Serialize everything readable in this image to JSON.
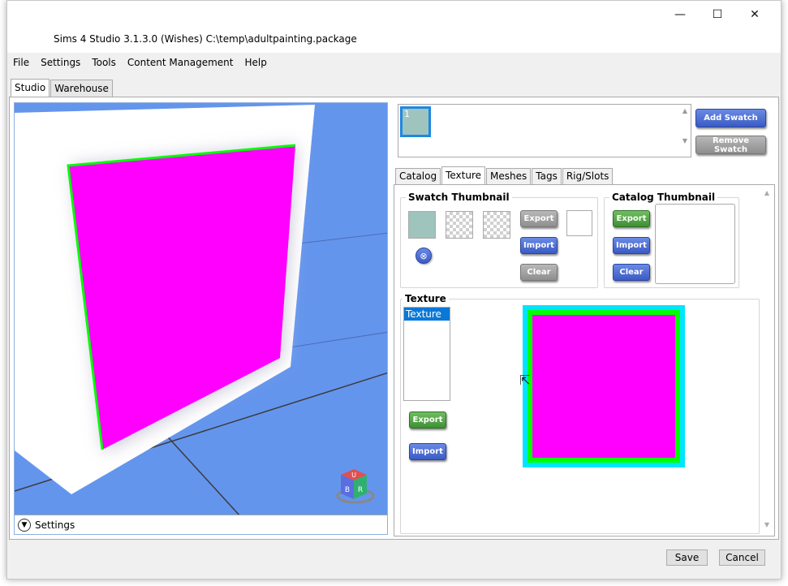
{
  "window": {
    "title": "Sims 4 Studio 3.1.3.0 (Wishes)  C:\\temp\\adultpainting.package",
    "minimize": "—",
    "maximize": "☐",
    "close": "✕"
  },
  "menu": [
    "File",
    "Settings",
    "Tools",
    "Content Management",
    "Help"
  ],
  "main_tabs": [
    "Studio",
    "Warehouse"
  ],
  "viewport": {
    "settings_label": "Settings",
    "gizmo_faces": [
      "U",
      "B",
      "R"
    ]
  },
  "swatches": {
    "items": [
      "1"
    ],
    "add_label": "Add Swatch",
    "remove_label": "Remove Swatch"
  },
  "sub_tabs": [
    "Catalog",
    "Texture",
    "Meshes",
    "Tags",
    "Rig/Slots"
  ],
  "swatch_thumbnail": {
    "title": "Swatch Thumbnail",
    "export_label": "Export",
    "import_label": "Import",
    "clear_label": "Clear",
    "remove_icon": "⊗"
  },
  "catalog_thumbnail": {
    "title": "Catalog Thumbnail",
    "export_label": "Export",
    "import_label": "Import",
    "clear_label": "Clear"
  },
  "texture": {
    "title": "Texture",
    "list": [
      "Texture"
    ],
    "export_label": "Export",
    "import_label": "Import"
  },
  "footer": {
    "save_label": "Save",
    "cancel_label": "Cancel"
  },
  "colors": {
    "magenta": "#ff00ff",
    "green": "#00ff00",
    "cyan": "#00e5ff",
    "viewport_bg": "#6495ed",
    "swatch": "#9fc4bd"
  }
}
